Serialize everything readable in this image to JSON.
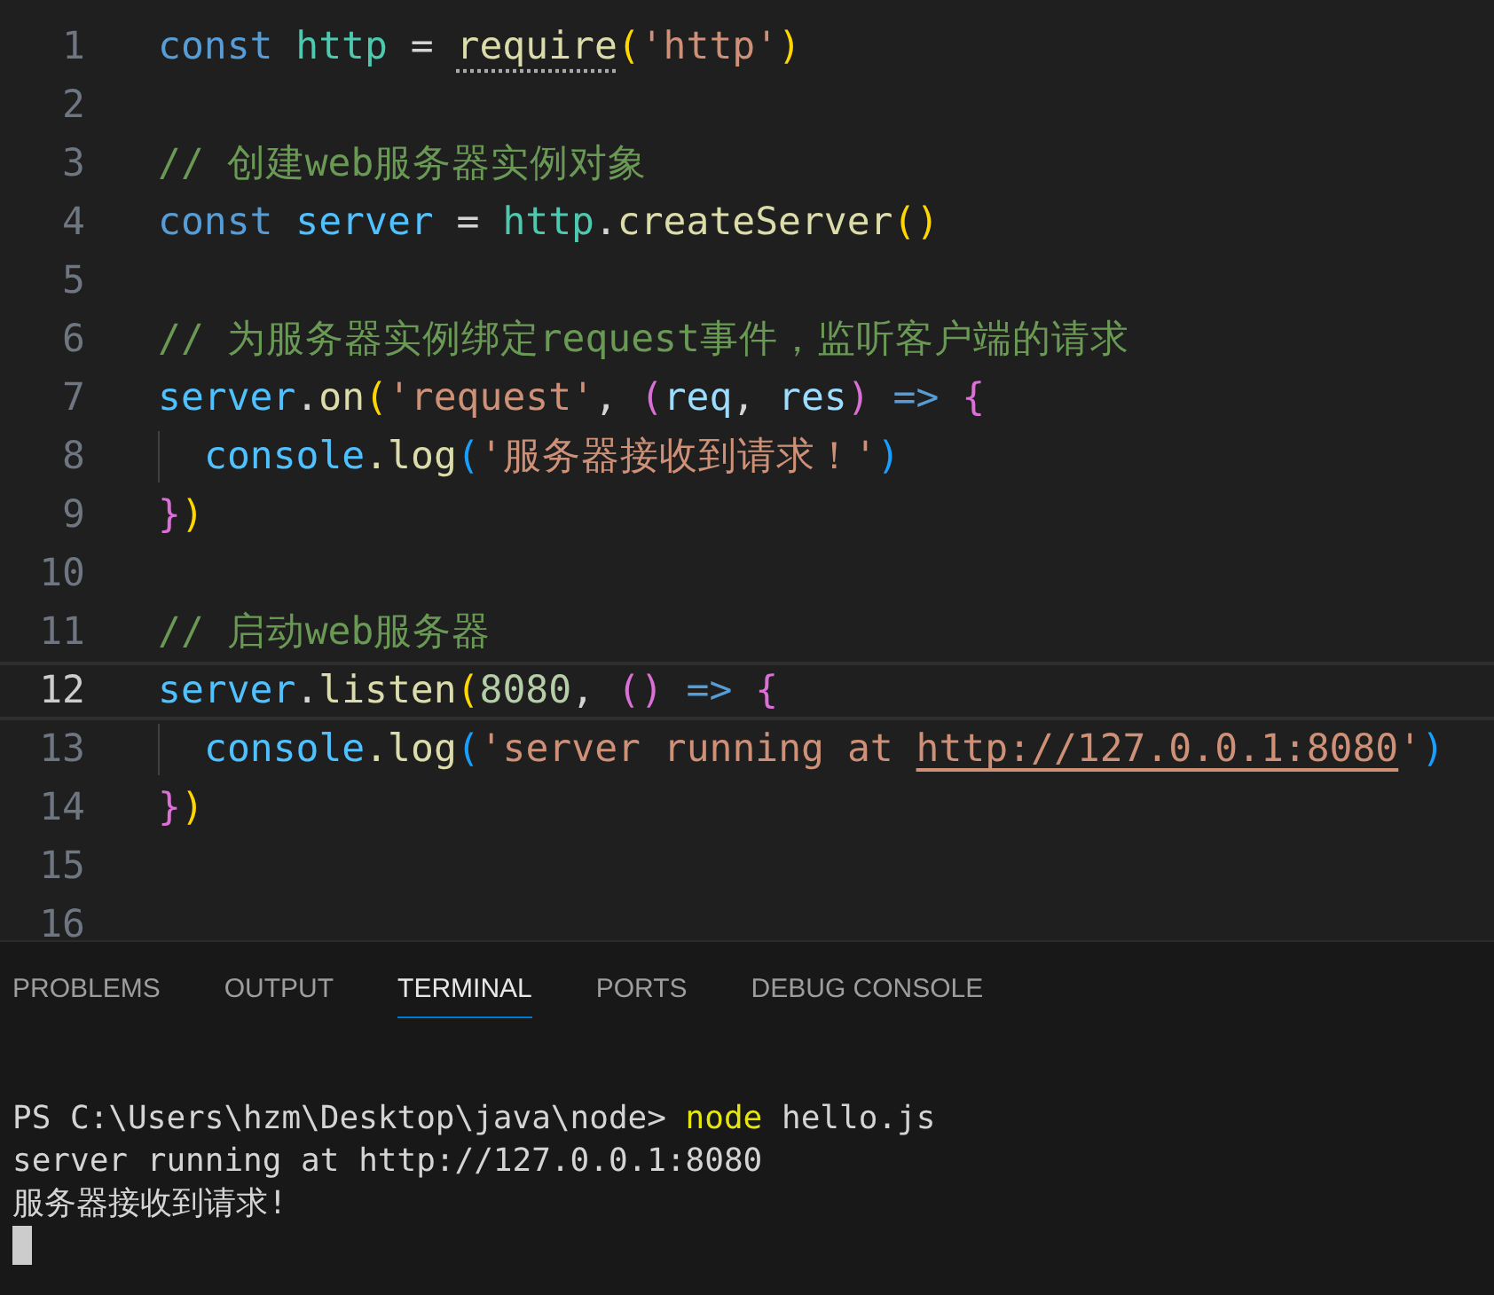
{
  "editor": {
    "lines": [
      {
        "number": "1",
        "active": false,
        "indented": false,
        "tokens": [
          {
            "t": "const ",
            "kind": "keyword"
          },
          {
            "t": "http",
            "kind": "module"
          },
          {
            "t": " = ",
            "kind": "plain"
          },
          {
            "t": "require",
            "kind": "hinted"
          },
          {
            "t": "(",
            "kind": "bracket1"
          },
          {
            "t": "'http'",
            "kind": "string"
          },
          {
            "t": ")",
            "kind": "bracket1"
          }
        ]
      },
      {
        "number": "2",
        "active": false,
        "indented": false
      },
      {
        "number": "3",
        "active": false,
        "indented": false,
        "tokens": [
          {
            "t": "// 创建web服务器实例对象",
            "kind": "comment"
          }
        ]
      },
      {
        "number": "4",
        "active": false,
        "indented": false,
        "tokens": [
          {
            "t": "const ",
            "kind": "keyword"
          },
          {
            "t": "server",
            "kind": "constant"
          },
          {
            "t": " = ",
            "kind": "plain"
          },
          {
            "t": "http",
            "kind": "module"
          },
          {
            "t": ".",
            "kind": "plain"
          },
          {
            "t": "createServer",
            "kind": "function"
          },
          {
            "t": "()",
            "kind": "bracket1"
          }
        ]
      },
      {
        "number": "5",
        "active": false,
        "indented": false
      },
      {
        "number": "6",
        "active": false,
        "indented": false,
        "tokens": [
          {
            "t": "// 为服务器实例绑定request事件，监听客户端的请求",
            "kind": "comment"
          }
        ]
      },
      {
        "number": "7",
        "active": false,
        "indented": false,
        "tokens": [
          {
            "t": "server",
            "kind": "constant"
          },
          {
            "t": ".",
            "kind": "plain"
          },
          {
            "t": "on",
            "kind": "function"
          },
          {
            "t": "(",
            "kind": "bracket1"
          },
          {
            "t": "'request'",
            "kind": "string"
          },
          {
            "t": ", ",
            "kind": "plain"
          },
          {
            "t": "(",
            "kind": "bracket2"
          },
          {
            "t": "req",
            "kind": "param"
          },
          {
            "t": ", ",
            "kind": "plain"
          },
          {
            "t": "res",
            "kind": "param"
          },
          {
            "t": ")",
            "kind": "bracket2"
          },
          {
            "t": " => ",
            "kind": "keyword"
          },
          {
            "t": "{",
            "kind": "bracket2"
          }
        ]
      },
      {
        "number": "8",
        "active": false,
        "indented": true,
        "tokens": [
          {
            "t": "console",
            "kind": "constant"
          },
          {
            "t": ".log",
            "kind": "function"
          },
          {
            "t": "(",
            "kind": "bracket3"
          },
          {
            "t": "'服务器接收到请求！'",
            "kind": "string"
          },
          {
            "t": ")",
            "kind": "bracket3"
          }
        ]
      },
      {
        "number": "9",
        "active": false,
        "indented": false,
        "tokens": [
          {
            "t": "}",
            "kind": "bracket2"
          },
          {
            "t": ")",
            "kind": "bracket1"
          }
        ]
      },
      {
        "number": "10",
        "active": false,
        "indented": false
      },
      {
        "number": "11",
        "active": false,
        "indented": false,
        "tokens": [
          {
            "t": "// 启动web服务器",
            "kind": "comment"
          }
        ]
      },
      {
        "number": "12",
        "active": true,
        "indented": false,
        "tokens": [
          {
            "t": "server",
            "kind": "constant"
          },
          {
            "t": ".",
            "kind": "plain"
          },
          {
            "t": "listen",
            "kind": "function"
          },
          {
            "t": "(",
            "kind": "bracket1"
          },
          {
            "t": "8080",
            "kind": "number"
          },
          {
            "t": ", ",
            "kind": "plain"
          },
          {
            "t": "()",
            "kind": "bracket2"
          },
          {
            "t": " => ",
            "kind": "keyword"
          },
          {
            "t": "{",
            "kind": "bracket2"
          }
        ]
      },
      {
        "number": "13",
        "active": false,
        "indented": true,
        "tokens": [
          {
            "t": "console",
            "kind": "constant"
          },
          {
            "t": ".log",
            "kind": "function"
          },
          {
            "t": "(",
            "kind": "bracket3"
          },
          {
            "t": "'server running at ",
            "kind": "string"
          },
          {
            "t": "http://127.0.0.1:8080",
            "kind": "link"
          },
          {
            "t": "'",
            "kind": "string"
          },
          {
            "t": ")",
            "kind": "bracket3"
          }
        ]
      },
      {
        "number": "14",
        "active": false,
        "indented": false,
        "tokens": [
          {
            "t": "}",
            "kind": "bracket2"
          },
          {
            "t": ")",
            "kind": "bracket1"
          }
        ]
      },
      {
        "number": "15",
        "active": false,
        "indented": false
      },
      {
        "number": "16",
        "active": false,
        "indented": false
      }
    ]
  },
  "panel": {
    "tabs": [
      {
        "label": "PROBLEMS",
        "selected": false
      },
      {
        "label": "OUTPUT",
        "selected": false
      },
      {
        "label": "TERMINAL",
        "selected": true
      },
      {
        "label": "PORTS",
        "selected": false
      },
      {
        "label": "DEBUG CONSOLE",
        "selected": false
      }
    ],
    "terminal": {
      "lines": [
        [
          {
            "t": "PS C:\\Users\\hzm\\Desktop\\java\\node> ",
            "kind": "plain"
          },
          {
            "t": "node",
            "kind": "command"
          },
          {
            "t": " hello.js",
            "kind": "plain"
          }
        ],
        [
          {
            "t": "server running at http://127.0.0.1:8080",
            "kind": "plain"
          }
        ],
        [
          {
            "t": "服务器接收到请求!",
            "kind": "plain"
          }
        ]
      ]
    }
  }
}
